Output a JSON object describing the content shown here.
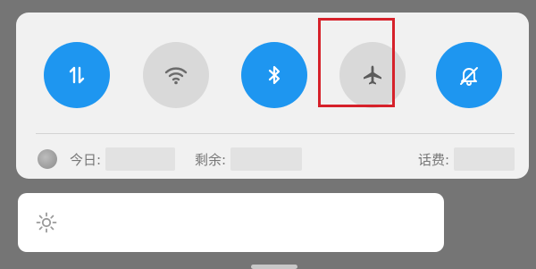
{
  "quick_toggles": [
    {
      "name": "mobile-data",
      "icon": "data-arrows-icon",
      "state": "on"
    },
    {
      "name": "wifi",
      "icon": "wifi-icon",
      "state": "off"
    },
    {
      "name": "bluetooth",
      "icon": "bluetooth-icon",
      "state": "on"
    },
    {
      "name": "airplane-mode",
      "icon": "airplane-icon",
      "state": "off",
      "highlighted": true
    },
    {
      "name": "silent",
      "icon": "bell-off-icon",
      "state": "on"
    }
  ],
  "data_usage": {
    "today_label": "今日:",
    "remaining_label": "剩余:",
    "balance_label": "话费:"
  },
  "colors": {
    "accent": "#1e96f0",
    "inactive": "#d9d9d9",
    "highlight": "#d6212a",
    "background": "#757575"
  }
}
